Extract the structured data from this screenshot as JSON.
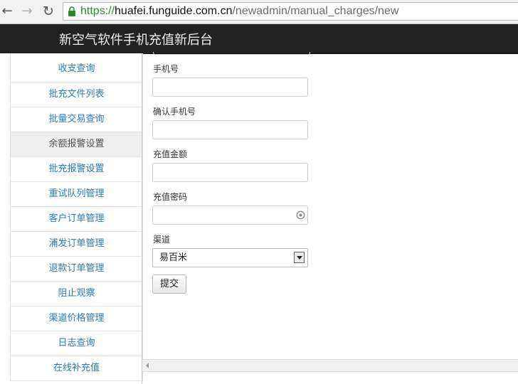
{
  "browser": {
    "url_scheme": "https://",
    "url_host": "huafei.funguide.com.cn",
    "url_path": "/newadmin/manual_charges/new"
  },
  "app": {
    "title": "新空气软件手机充值新后台"
  },
  "sidebar": {
    "items": [
      {
        "label": "收支查询"
      },
      {
        "label": "批充文件列表"
      },
      {
        "label": "批量交易查询"
      },
      {
        "label": "余额报警设置",
        "active": true
      },
      {
        "label": "批充报警设置"
      },
      {
        "label": "重试队列管理"
      },
      {
        "label": "客户订单管理"
      },
      {
        "label": "浦发订单管理"
      },
      {
        "label": "退款订单管理"
      },
      {
        "label": "阻止观察"
      },
      {
        "label": "渠道价格管理"
      },
      {
        "label": "日志查询"
      },
      {
        "label": "在线补充值"
      }
    ]
  },
  "form": {
    "phone_label": "手机号",
    "phone_value": "",
    "confirm_phone_label": "确认手机号",
    "confirm_phone_value": "",
    "amount_label": "充值金额",
    "amount_value": "",
    "password_label": "充值密码",
    "password_value": "",
    "channel_label": "渠道",
    "channel_selected": "易百米",
    "submit_label": "提交"
  },
  "colors": {
    "header_bg": "#222222",
    "link": "#2a7bb8",
    "active_bg": "#eeeeee",
    "url_secure": "#2b8a2b"
  }
}
